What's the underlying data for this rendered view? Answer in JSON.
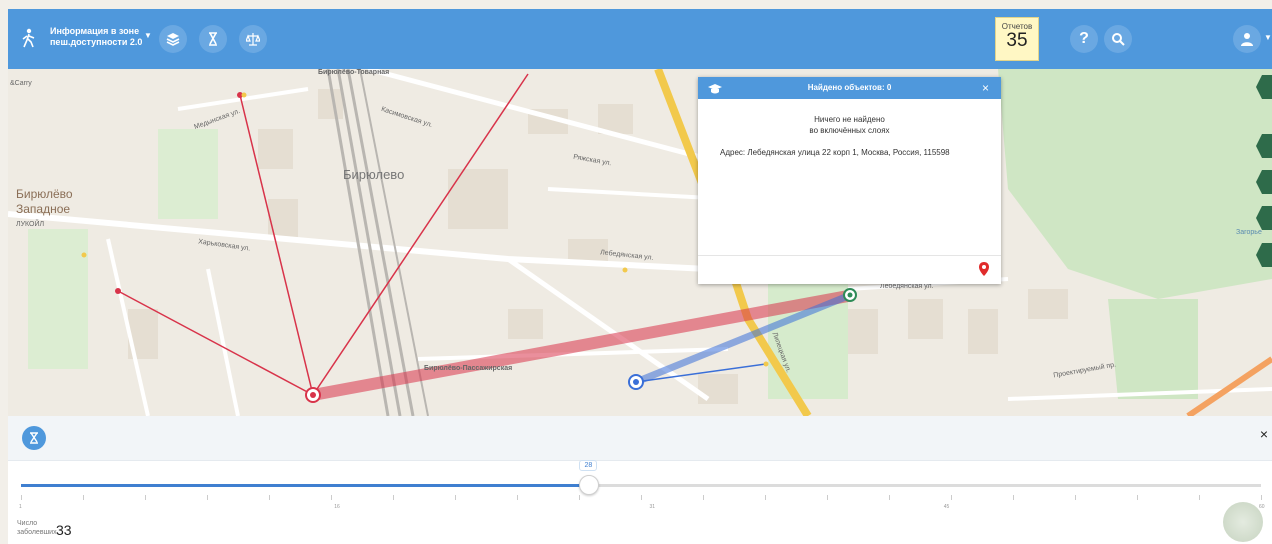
{
  "header": {
    "title_line1": "Информация в зоне",
    "title_line2": "пеш.доступности 2.0",
    "reports_label": "Отчетов",
    "reports_count": "35",
    "help_label": "?"
  },
  "map": {
    "labels": {
      "station1": "Бирюлёво-Товарная",
      "carry": "&Carry",
      "medynskaya": "Медынская ул.",
      "kasimovskaya": "Касимовская ул.",
      "biryulevo": "Бирюлево",
      "biryulevo_zap1": "Бирюлёво",
      "biryulevo_zap2": "Западное",
      "lukoil": "ЛУКОЙЛ",
      "kharkovskaya": "Харьковская ул.",
      "ryazhskaya": "Ряжская ул.",
      "lebedyanskaya1": "Лебедянская ул.",
      "lebedyanskaya2": "Лебедянская ул.",
      "station2": "Бирюлёво-Пассажирская",
      "lipetskaya": "Липецкая ул.",
      "proektiruemy": "Проектируемый пр.",
      "zagorye": "Загорье"
    }
  },
  "popup": {
    "title": "Найдено объектов: 0",
    "message_line1": "Ничего не найдено",
    "message_line2": "во включённых слоях",
    "address": "Адрес: Лебедянская улица 22 корп 1, Москва, Россия, 115598",
    "close": "×"
  },
  "timeline": {
    "close": "×",
    "value": 28,
    "value_label": "28",
    "min": 1,
    "max": 60,
    "tick_labels": [
      "1",
      "16",
      "31",
      "45",
      "60"
    ],
    "count_label_line1": "Число",
    "count_label_line2": "заболевших",
    "count_value": "33"
  },
  "colors": {
    "brand": "#4f98dc",
    "accent_red": "#d8334a",
    "route_blue": "#3a6fd8",
    "side_green": "#2e6b4a"
  }
}
